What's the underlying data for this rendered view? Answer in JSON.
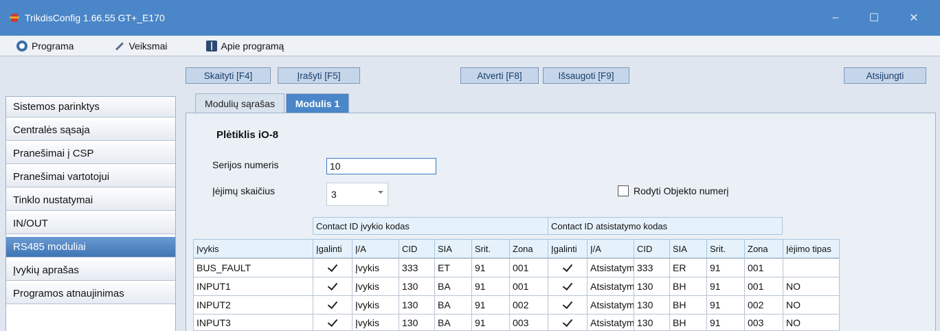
{
  "window": {
    "title": "TrikdisConfig 1.66.55   GT+_E170",
    "minimize": "–",
    "maximize": "☐",
    "close": "✕"
  },
  "menu": [
    {
      "label": "Programa",
      "icon": "gear-icon"
    },
    {
      "label": "Veiksmai",
      "icon": "wrench-icon"
    },
    {
      "label": "Apie programą",
      "icon": "book-icon"
    }
  ],
  "toolbar": {
    "read": "Skaityti [F4]",
    "write": "Įrašyti [F5]",
    "open": "Atverti [F8]",
    "save": "Išsaugoti [F9]",
    "disconnect": "Atsijungti"
  },
  "sidebar": {
    "items": [
      {
        "label": "Sistemos parinktys",
        "active": false
      },
      {
        "label": "Centralės sąsaja",
        "active": false
      },
      {
        "label": "Pranešimai į CSP",
        "active": false
      },
      {
        "label": "Pranešimai vartotojui",
        "active": false
      },
      {
        "label": "Tinklo nustatymai",
        "active": false
      },
      {
        "label": "IN/OUT",
        "active": false
      },
      {
        "label": "RS485 moduliai",
        "active": true
      },
      {
        "label": "Įvykių aprašas",
        "active": false
      },
      {
        "label": "Programos atnaujinimas",
        "active": false
      }
    ]
  },
  "tabs": [
    {
      "label": "Modulių sąrašas",
      "active": false
    },
    {
      "label": "Modulis 1",
      "active": true
    }
  ],
  "module": {
    "heading": "Plėtiklis iO-8",
    "serial_label": "Serijos numeris",
    "serial_value": "10",
    "inputs_label": "Įėjimų skaičius",
    "inputs_value": "3",
    "show_object_label": "Rodyti Objekto numerį",
    "show_object_checked": false
  },
  "grid": {
    "group_headers": [
      "Contact ID įvykio kodas",
      "Contact ID atsistatymo kodas"
    ],
    "columns": [
      "Įvykis",
      "Įgalinti",
      "Į/A",
      "CID",
      "SIA",
      "Srit.",
      "Zona",
      "Įgalinti",
      "Į/A",
      "CID",
      "SIA",
      "Srit.",
      "Zona",
      "Įėjimo tipas"
    ],
    "rows": [
      {
        "event": "BUS_FAULT",
        "enable1": true,
        "ia1": "Įvykis",
        "cid1": "333",
        "sia1": "ET",
        "area1": "91",
        "zone1": "001",
        "enable2": true,
        "ia2": "Atsistatymas",
        "cid2": "333",
        "sia2": "ER",
        "area2": "91",
        "zone2": "001",
        "type": ""
      },
      {
        "event": "INPUT1",
        "enable1": true,
        "ia1": "Įvykis",
        "cid1": "130",
        "sia1": "BA",
        "area1": "91",
        "zone1": "001",
        "enable2": true,
        "ia2": "Atsistatymas",
        "cid2": "130",
        "sia2": "BH",
        "area2": "91",
        "zone2": "001",
        "type": "NO"
      },
      {
        "event": "INPUT2",
        "enable1": true,
        "ia1": "Įvykis",
        "cid1": "130",
        "sia1": "BA",
        "area1": "91",
        "zone1": "002",
        "enable2": true,
        "ia2": "Atsistatymas",
        "cid2": "130",
        "sia2": "BH",
        "area2": "91",
        "zone2": "002",
        "type": "NO"
      },
      {
        "event": "INPUT3",
        "enable1": true,
        "ia1": "Įvykis",
        "cid1": "130",
        "sia1": "BA",
        "area1": "91",
        "zone1": "003",
        "enable2": true,
        "ia2": "Atsistatymas",
        "cid2": "130",
        "sia2": "BH",
        "area2": "91",
        "zone2": "003",
        "type": "NO"
      }
    ]
  },
  "colors": {
    "titlebar": "#4a86c8",
    "accent": "#3f75b5",
    "button": "#c6d6ea"
  }
}
